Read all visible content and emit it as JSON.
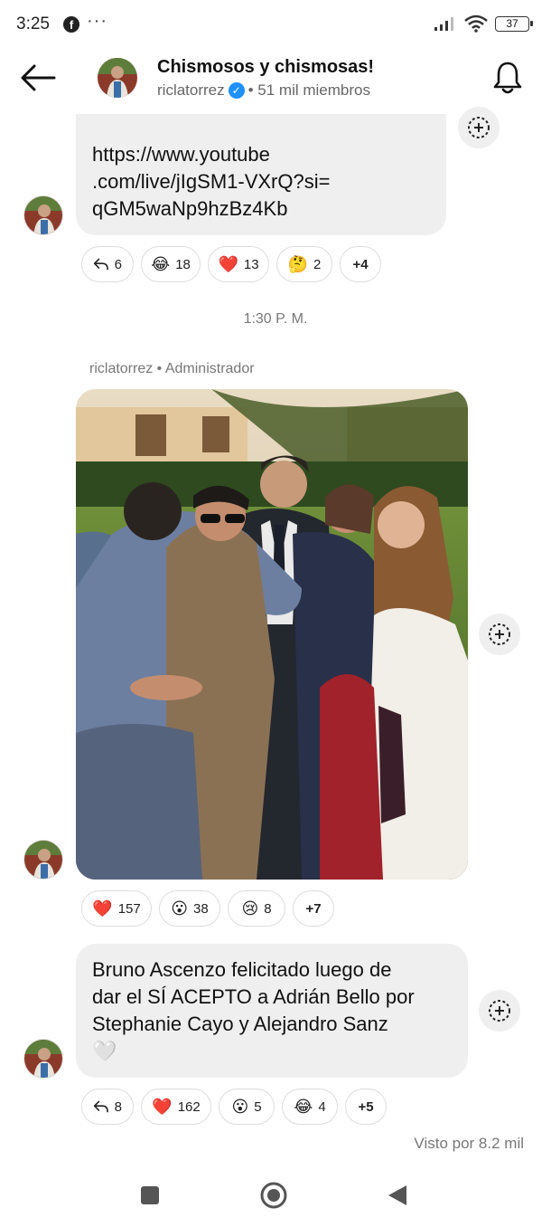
{
  "status_bar": {
    "time": "3:25",
    "facebook_icon": "f",
    "more_dots": "···",
    "battery": "37"
  },
  "header": {
    "title": "Chismosos y chismosas!",
    "username": "riclatorrez",
    "verified_mark": "✓",
    "members": "• 51 mil miembros"
  },
  "messages": [
    {
      "type": "text",
      "lines": [
        "https://www.youtube",
        ".com/live/jIgSM1-VXrQ?si=",
        "qGM5waNp9hzBz4Kb"
      ],
      "reactions": [
        {
          "icon": "reply-icon",
          "emoji": "↩",
          "count": "6"
        },
        {
          "icon": "laughing-emoji",
          "emoji": "😂",
          "count": "18"
        },
        {
          "icon": "heart-emoji",
          "emoji": "❤️",
          "count": "13"
        },
        {
          "icon": "thinking-emoji",
          "emoji": "🤔",
          "count": "2"
        },
        {
          "icon": "more",
          "emoji": "",
          "count": "+4"
        }
      ]
    },
    {
      "type": "photo",
      "timestamp": "1:30 P. M.",
      "sender": "riclatorrez • Administrador",
      "reactions": [
        {
          "icon": "heart-emoji",
          "emoji": "❤️",
          "count": "157"
        },
        {
          "icon": "surprised-emoji",
          "emoji": "😮",
          "count": "38"
        },
        {
          "icon": "sad-emoji",
          "emoji": "😢",
          "count": "8"
        },
        {
          "icon": "more",
          "emoji": "",
          "count": "+7"
        }
      ]
    },
    {
      "type": "text",
      "lines": [
        "Bruno Ascenzo felicitado luego de",
        "dar el SÍ ACEPTO a Adrián Bello por",
        "Stephanie Cayo y Alejandro Sanz",
        "🤍"
      ],
      "reactions": [
        {
          "icon": "reply-icon",
          "emoji": "↩",
          "count": "8"
        },
        {
          "icon": "heart-emoji",
          "emoji": "❤️",
          "count": "162"
        },
        {
          "icon": "surprised-emoji",
          "emoji": "😮",
          "count": "5"
        },
        {
          "icon": "laughing-emoji",
          "emoji": "😂",
          "count": "4"
        },
        {
          "icon": "more",
          "emoji": "",
          "count": "+5"
        }
      ]
    }
  ],
  "seen_by": "Visto por 8.2 mil"
}
